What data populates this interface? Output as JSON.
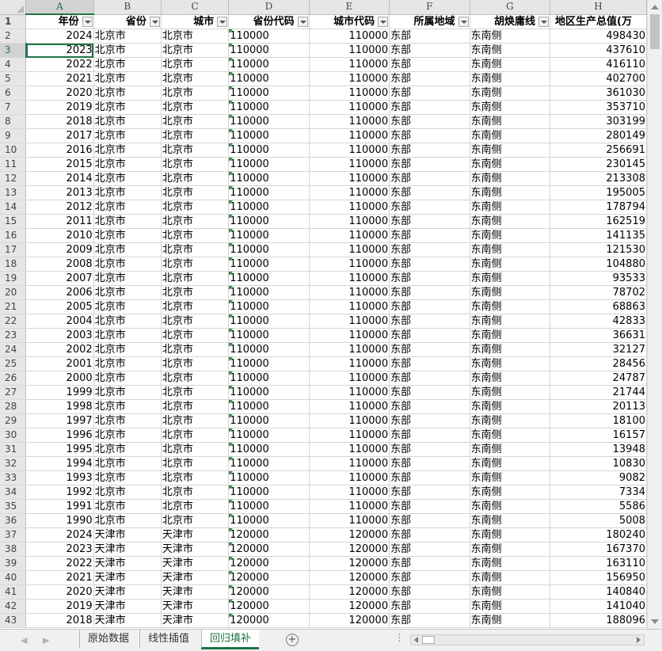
{
  "columns": [
    "A",
    "B",
    "C",
    "D",
    "E",
    "F",
    "G",
    "H"
  ],
  "headers": [
    "年份",
    "省份",
    "城市",
    "省份代码",
    "城市代码",
    "所属地域",
    "胡焕庸线",
    "地区生产总值(万"
  ],
  "rows": [
    [
      "2024",
      "北京市",
      "北京市",
      "110000",
      "110000",
      "东部",
      "东南侧",
      "498430"
    ],
    [
      "2023",
      "北京市",
      "北京市",
      "110000",
      "110000",
      "东部",
      "东南侧",
      "437610"
    ],
    [
      "2022",
      "北京市",
      "北京市",
      "110000",
      "110000",
      "东部",
      "东南侧",
      "416110"
    ],
    [
      "2021",
      "北京市",
      "北京市",
      "110000",
      "110000",
      "东部",
      "东南侧",
      "402700"
    ],
    [
      "2020",
      "北京市",
      "北京市",
      "110000",
      "110000",
      "东部",
      "东南侧",
      "361030"
    ],
    [
      "2019",
      "北京市",
      "北京市",
      "110000",
      "110000",
      "东部",
      "东南侧",
      "353710"
    ],
    [
      "2018",
      "北京市",
      "北京市",
      "110000",
      "110000",
      "东部",
      "东南侧",
      "303199"
    ],
    [
      "2017",
      "北京市",
      "北京市",
      "110000",
      "110000",
      "东部",
      "东南侧",
      "280149"
    ],
    [
      "2016",
      "北京市",
      "北京市",
      "110000",
      "110000",
      "东部",
      "东南侧",
      "256691"
    ],
    [
      "2015",
      "北京市",
      "北京市",
      "110000",
      "110000",
      "东部",
      "东南侧",
      "230145"
    ],
    [
      "2014",
      "北京市",
      "北京市",
      "110000",
      "110000",
      "东部",
      "东南侧",
      "213308"
    ],
    [
      "2013",
      "北京市",
      "北京市",
      "110000",
      "110000",
      "东部",
      "东南侧",
      "195005"
    ],
    [
      "2012",
      "北京市",
      "北京市",
      "110000",
      "110000",
      "东部",
      "东南侧",
      "178794"
    ],
    [
      "2011",
      "北京市",
      "北京市",
      "110000",
      "110000",
      "东部",
      "东南侧",
      "162519"
    ],
    [
      "2010",
      "北京市",
      "北京市",
      "110000",
      "110000",
      "东部",
      "东南侧",
      "141135"
    ],
    [
      "2009",
      "北京市",
      "北京市",
      "110000",
      "110000",
      "东部",
      "东南侧",
      "121530"
    ],
    [
      "2008",
      "北京市",
      "北京市",
      "110000",
      "110000",
      "东部",
      "东南侧",
      "104880"
    ],
    [
      "2007",
      "北京市",
      "北京市",
      "110000",
      "110000",
      "东部",
      "东南侧",
      "93533"
    ],
    [
      "2006",
      "北京市",
      "北京市",
      "110000",
      "110000",
      "东部",
      "东南侧",
      "78702"
    ],
    [
      "2005",
      "北京市",
      "北京市",
      "110000",
      "110000",
      "东部",
      "东南侧",
      "68863"
    ],
    [
      "2004",
      "北京市",
      "北京市",
      "110000",
      "110000",
      "东部",
      "东南侧",
      "42833"
    ],
    [
      "2003",
      "北京市",
      "北京市",
      "110000",
      "110000",
      "东部",
      "东南侧",
      "36631"
    ],
    [
      "2002",
      "北京市",
      "北京市",
      "110000",
      "110000",
      "东部",
      "东南侧",
      "32127"
    ],
    [
      "2001",
      "北京市",
      "北京市",
      "110000",
      "110000",
      "东部",
      "东南侧",
      "28456"
    ],
    [
      "2000",
      "北京市",
      "北京市",
      "110000",
      "110000",
      "东部",
      "东南侧",
      "24787"
    ],
    [
      "1999",
      "北京市",
      "北京市",
      "110000",
      "110000",
      "东部",
      "东南侧",
      "21744"
    ],
    [
      "1998",
      "北京市",
      "北京市",
      "110000",
      "110000",
      "东部",
      "东南侧",
      "20113"
    ],
    [
      "1997",
      "北京市",
      "北京市",
      "110000",
      "110000",
      "东部",
      "东南侧",
      "18100"
    ],
    [
      "1996",
      "北京市",
      "北京市",
      "110000",
      "110000",
      "东部",
      "东南侧",
      "16157"
    ],
    [
      "1995",
      "北京市",
      "北京市",
      "110000",
      "110000",
      "东部",
      "东南侧",
      "13948"
    ],
    [
      "1994",
      "北京市",
      "北京市",
      "110000",
      "110000",
      "东部",
      "东南侧",
      "10830"
    ],
    [
      "1993",
      "北京市",
      "北京市",
      "110000",
      "110000",
      "东部",
      "东南侧",
      "9082"
    ],
    [
      "1992",
      "北京市",
      "北京市",
      "110000",
      "110000",
      "东部",
      "东南侧",
      "7334"
    ],
    [
      "1991",
      "北京市",
      "北京市",
      "110000",
      "110000",
      "东部",
      "东南侧",
      "5586"
    ],
    [
      "1990",
      "北京市",
      "北京市",
      "110000",
      "110000",
      "东部",
      "东南侧",
      "5008"
    ],
    [
      "2024",
      "天津市",
      "天津市",
      "120000",
      "120000",
      "东部",
      "东南侧",
      "180240"
    ],
    [
      "2023",
      "天津市",
      "天津市",
      "120000",
      "120000",
      "东部",
      "东南侧",
      "167370"
    ],
    [
      "2022",
      "天津市",
      "天津市",
      "120000",
      "120000",
      "东部",
      "东南侧",
      "163110"
    ],
    [
      "2021",
      "天津市",
      "天津市",
      "120000",
      "120000",
      "东部",
      "东南侧",
      "156950"
    ],
    [
      "2020",
      "天津市",
      "天津市",
      "120000",
      "120000",
      "东部",
      "东南侧",
      "140840"
    ],
    [
      "2019",
      "天津市",
      "天津市",
      "120000",
      "120000",
      "东部",
      "东南侧",
      "141040"
    ],
    [
      "2018",
      "天津市",
      "天津市",
      "120000",
      "120000",
      "东部",
      "东南侧",
      "188096"
    ]
  ],
  "sheets": [
    {
      "label": "原始数据",
      "active": false
    },
    {
      "label": "线性插值",
      "active": false
    },
    {
      "label": "回归填补",
      "active": true
    }
  ],
  "add_sheet_label": "+",
  "dots_label": "⋮",
  "selected_row": "3",
  "selected_column": "A"
}
